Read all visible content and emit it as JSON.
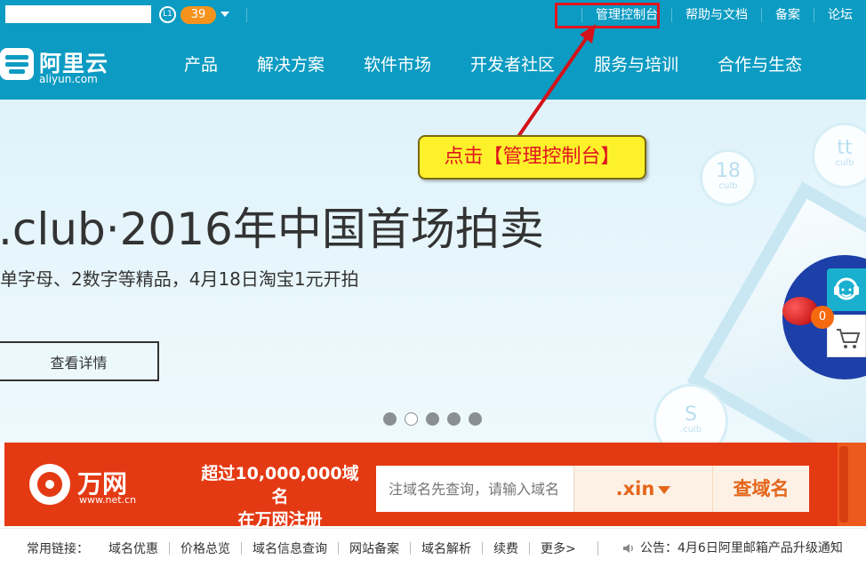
{
  "topbar": {
    "level_badge": "L1",
    "points": "39",
    "links": [
      "管理控制台",
      "帮助与文档",
      "备案",
      "论坛"
    ]
  },
  "nav": {
    "logo_name": "阿里云",
    "logo_domain": "aliyun.com",
    "items": [
      "产品",
      "解决方案",
      "软件市场",
      "开发者社区",
      "服务与培训",
      "合作与生态"
    ]
  },
  "banner": {
    "title": ".club·2016年中国首场拍卖",
    "subtitle": "单字母、2数字等精品，4月18日淘宝1元开拍",
    "button": "查看详情",
    "bubbles": [
      {
        "big": "18",
        "small": "culb"
      },
      {
        "big": "tt",
        "small": "culb"
      },
      {
        "big": "S",
        "small": ".culb"
      }
    ],
    "carousel_count": 5,
    "carousel_active": 1
  },
  "annotation": {
    "callout": "点击【管理控制台】",
    "highlight_color": "#e0161d",
    "callout_bg": "#fdf12b"
  },
  "side": {
    "cart_count": "0"
  },
  "domain": {
    "brand": "万网",
    "site": "www.net.cn",
    "slogan_line1": "超过10,000,000域名",
    "slogan_line2": "在万网注册",
    "search_placeholder": "注域名先查询，请输入域名",
    "tld": ".xin",
    "search_button": "查域名"
  },
  "bottom": {
    "label": "常用链接：",
    "links": [
      "域名优惠",
      "价格总览",
      "域名信息查询",
      "网站备案",
      "域名解析",
      "续费",
      "更多>"
    ],
    "notice": "公告：4月6日阿里邮箱产品升级通知"
  },
  "colors": {
    "brand_blue": "#0c9bc2",
    "wanwang_red": "#e43a13",
    "accent_orange": "#f7931d"
  }
}
